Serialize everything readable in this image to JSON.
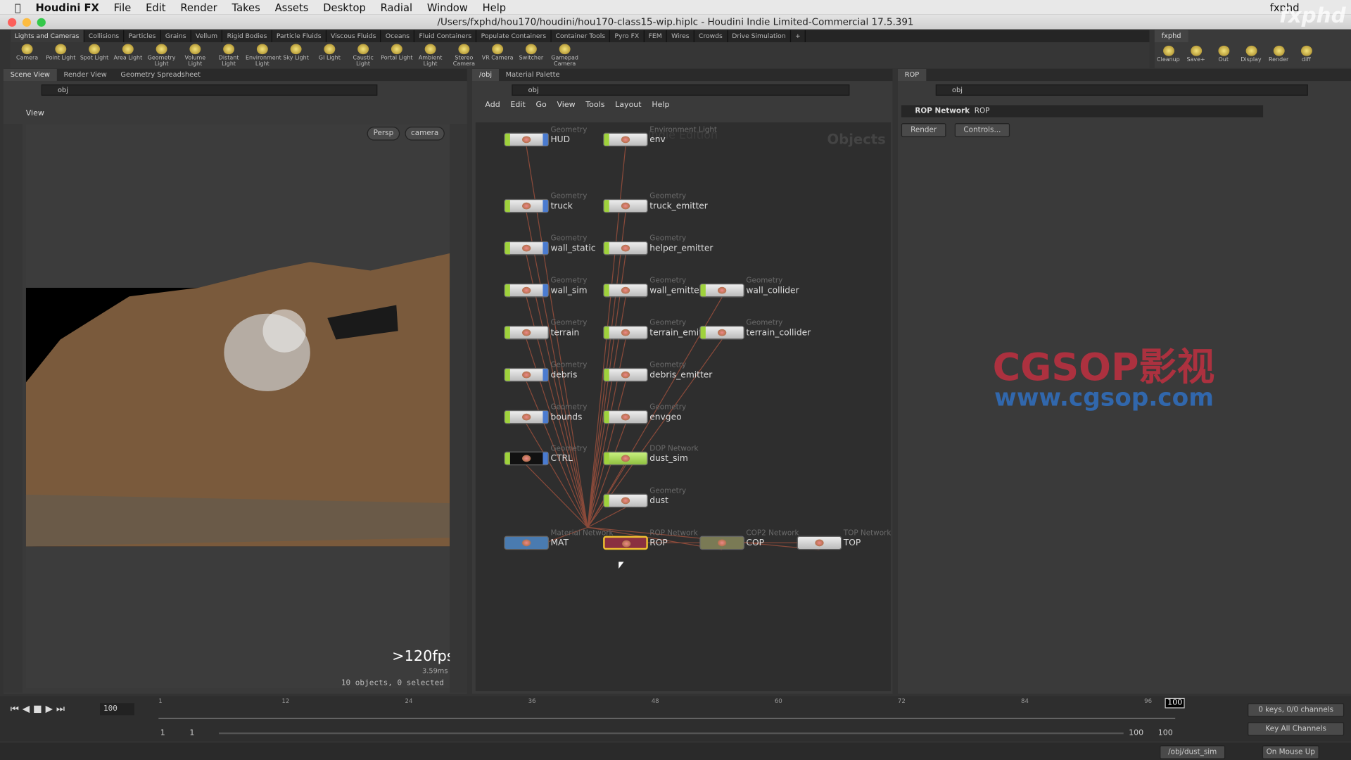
{
  "menubar": {
    "app": "Houdini FX",
    "items": [
      "File",
      "Edit",
      "Render",
      "Takes",
      "Assets",
      "Desktop",
      "Radial",
      "Window",
      "Help"
    ],
    "user": "fxphd"
  },
  "window_title": "/Users/fxphd/hou170/houdini/hou170-class15-wip.hiplc - Houdini Indie Limited-Commercial 17.5.391",
  "watermark_logo": "fxphd",
  "shelf_tabs": [
    "Lights and Cameras",
    "Collisions",
    "Particles",
    "Grains",
    "Vellum",
    "Rigid Bodies",
    "Particle Fluids",
    "Viscous Fluids",
    "Oceans",
    "Fluid Containers",
    "Populate Containers",
    "Container Tools",
    "Pyro FX",
    "FEM",
    "Wires",
    "Crowds",
    "Drive Simulation",
    "+"
  ],
  "shelf_tools": [
    "Camera",
    "Point Light",
    "Spot Light",
    "Area Light",
    "Geometry Light",
    "Volume Light",
    "Distant Light",
    "Environment Light",
    "Sky Light",
    "GI Light",
    "Caustic Light",
    "Portal Light",
    "Ambient Light",
    "Stereo Camera",
    "VR Camera",
    "Switcher",
    "Gamepad Camera"
  ],
  "right_shelf": {
    "tab": "fxphd",
    "tools": [
      "Cleanup",
      "Save+",
      "Out",
      "Display",
      "Render",
      "diff"
    ]
  },
  "scene_pane": {
    "tabs": [
      "Scene View",
      "Render View",
      "Geometry Spreadsheet"
    ],
    "path": "obj",
    "view_label": "View",
    "persp": "Persp",
    "camera": "camera",
    "fps": ">120fps",
    "ms": "3.59ms",
    "status": "10 objects, 0 selected"
  },
  "network_pane": {
    "tabs": [
      "/obj",
      "Material Palette"
    ],
    "path": "obj",
    "menu": [
      "Add",
      "Edit",
      "Go",
      "View",
      "Tools",
      "Layout",
      "Help"
    ],
    "context_label": "Objects",
    "edition_watermark": "Indie Edition",
    "nodes": [
      {
        "type": "Geometry",
        "name": "HUD"
      },
      {
        "type": "Environment Light",
        "name": "env"
      },
      {
        "type": "Geometry",
        "name": "truck"
      },
      {
        "type": "Geometry",
        "name": "truck_emitter"
      },
      {
        "type": "Geometry",
        "name": "wall_static"
      },
      {
        "type": "Geometry",
        "name": "helper_emitter"
      },
      {
        "type": "Geometry",
        "name": "wall_sim"
      },
      {
        "type": "Geometry",
        "name": "wall_emitter"
      },
      {
        "type": "Geometry",
        "name": "wall_collider"
      },
      {
        "type": "Geometry",
        "name": "terrain"
      },
      {
        "type": "Geometry",
        "name": "terrain_emitter"
      },
      {
        "type": "Geometry",
        "name": "terrain_collider"
      },
      {
        "type": "Geometry",
        "name": "debris"
      },
      {
        "type": "Geometry",
        "name": "debris_emitter"
      },
      {
        "type": "Geometry",
        "name": "bounds"
      },
      {
        "type": "Geometry",
        "name": "envgeo"
      },
      {
        "type": "Geometry",
        "name": "CTRL"
      },
      {
        "type": "DOP Network",
        "name": "dust_sim"
      },
      {
        "type": "Geometry",
        "name": "dust"
      },
      {
        "type": "Material Network",
        "name": "MAT"
      },
      {
        "type": "ROP Network",
        "name": "ROP"
      },
      {
        "type": "COP2 Network",
        "name": "COP"
      },
      {
        "type": "TOP Network",
        "name": "TOP"
      }
    ]
  },
  "param_pane": {
    "tab": "ROP",
    "path": "obj",
    "node_type": "ROP Network",
    "node_name": "ROP",
    "buttons": [
      "Render",
      "Controls..."
    ]
  },
  "watermark": {
    "brand": "CGSOP影视",
    "url": "www.cgsop.com"
  },
  "timeline": {
    "ticks": [
      "1",
      "12",
      "24",
      "36",
      "48",
      "60",
      "72",
      "84",
      "96"
    ],
    "current_frame": "100",
    "frame_field": "100",
    "start": "1",
    "start2": "1",
    "end": "100",
    "end2": "100",
    "keys": "0 keys, 0/0 channels",
    "key_all": "Key All Channels"
  },
  "statusbar": {
    "path": "/obj/dust_sim",
    "update_mode": "On Mouse Up"
  }
}
